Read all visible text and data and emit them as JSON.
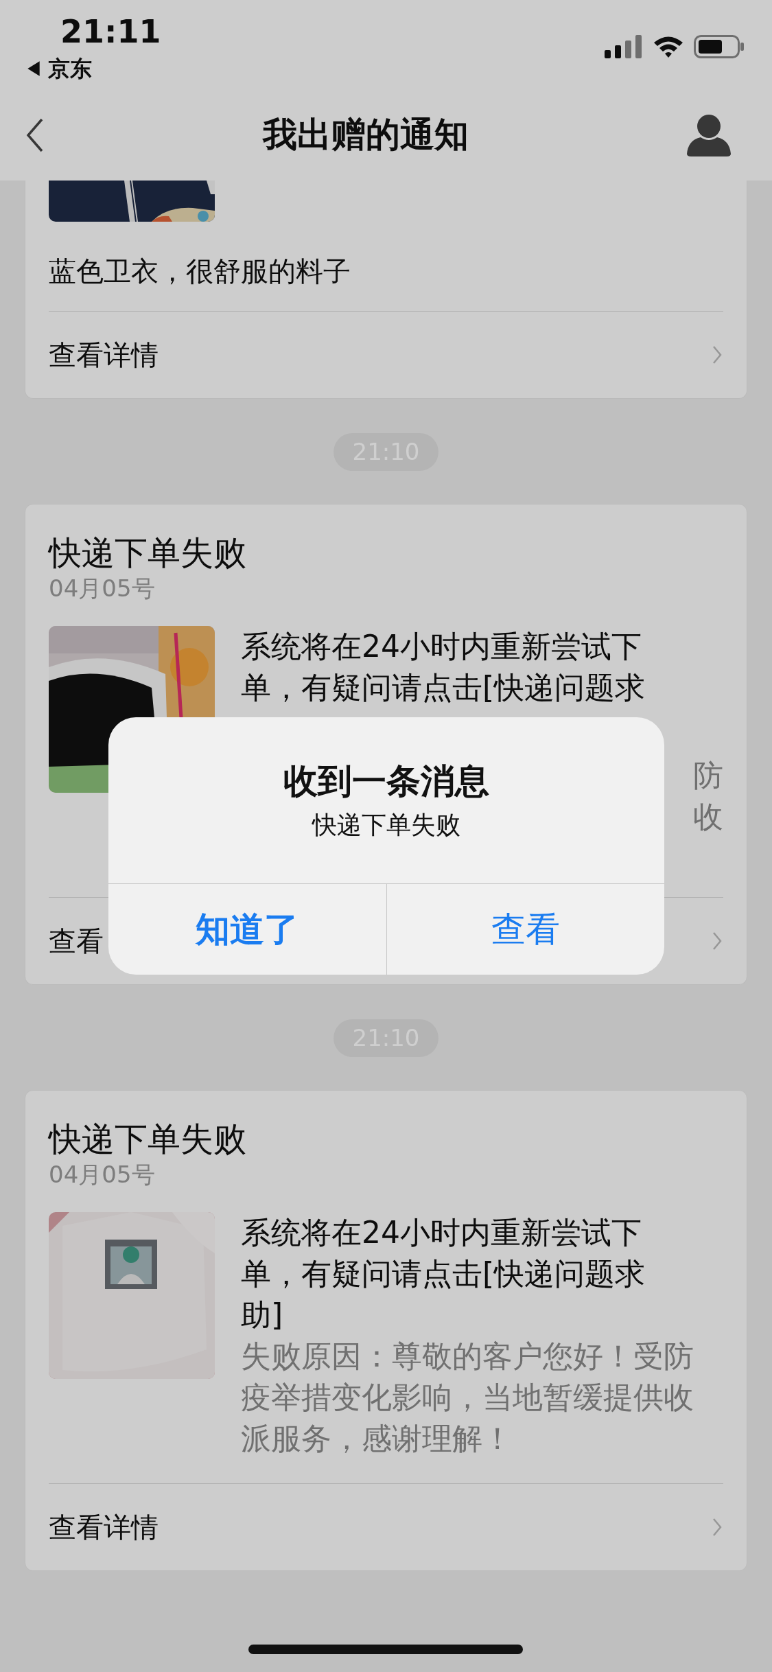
{
  "status_bar": {
    "time": "21:11",
    "back_app": "京东"
  },
  "nav": {
    "title": "我出赠的通知"
  },
  "items": [
    {
      "kind": "note",
      "description": "蓝色卫衣，很舒服的料子",
      "link": "查看详情"
    },
    {
      "kind": "time",
      "text": "21:10"
    },
    {
      "kind": "notice",
      "title": "快递下单失败",
      "date": "04月05号",
      "message_lines": [
        "系统将在24小时内重新尝试下",
        "单，有疑问请点击[快递问题求"
      ],
      "reason_line_ends": [
        "防",
        "收"
      ],
      "link": "查看"
    },
    {
      "kind": "time",
      "text": "21:10"
    },
    {
      "kind": "notice",
      "title": "快递下单失败",
      "date": "04月05号",
      "message_lines": [
        "系统将在24小时内重新尝试下",
        "单，有疑问请点击[快递问题求",
        "助]"
      ],
      "reason_lines": [
        "失败原因：尊敬的客户您好！受防",
        "疫举措变化影响，当地暂缓提供收",
        "派服务，感谢理解！"
      ],
      "link": "查看详情"
    }
  ],
  "alert": {
    "title": "收到一条消息",
    "message": "快递下单失败",
    "buttons": [
      {
        "label": "知道了",
        "kind": "primary"
      },
      {
        "label": "查看",
        "kind": "default"
      }
    ]
  }
}
